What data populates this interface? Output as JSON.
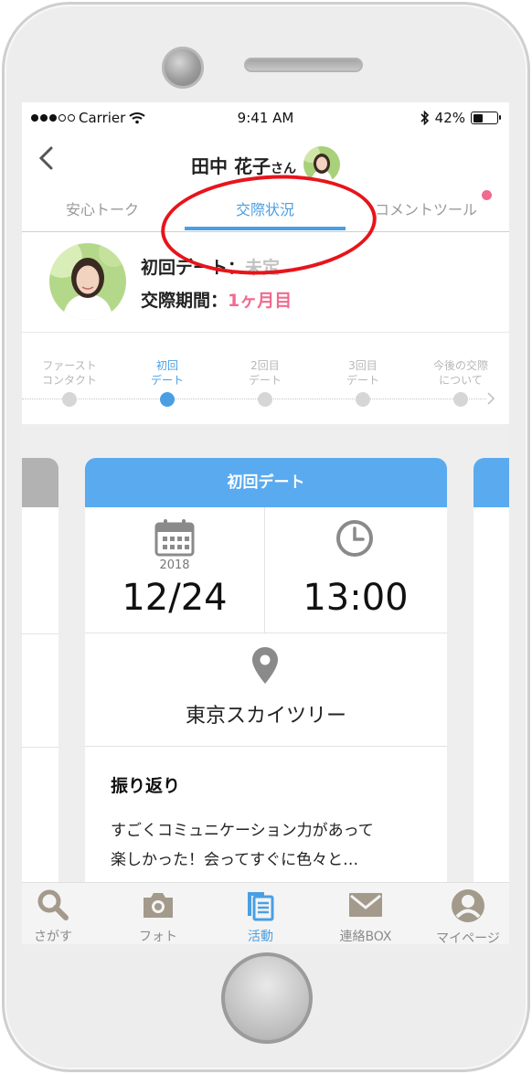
{
  "status_bar": {
    "carrier": "Carrier",
    "time": "9:41 AM",
    "battery": "42%",
    "battery_level": 0.42
  },
  "header": {
    "name": "田中 花子",
    "honorific": "さん"
  },
  "tabs": [
    {
      "label": "安心トーク",
      "active": false
    },
    {
      "label": "交際状況",
      "active": true
    },
    {
      "label": "コメントツール",
      "active": false,
      "badge": true
    }
  ],
  "profile": {
    "first_date_label": "初回デート：",
    "first_date_value": "未定",
    "period_label": "交際期間：",
    "period_value": "1ヶ月目"
  },
  "steps": [
    {
      "line1": "ファースト",
      "line2": "コンタクト",
      "active": false
    },
    {
      "line1": "初回",
      "line2": "デート",
      "active": true
    },
    {
      "line1": "2回目",
      "line2": "デート",
      "active": false
    },
    {
      "line1": "3回目",
      "line2": "デート",
      "active": false
    },
    {
      "line1": "今後の交際",
      "line2": "について",
      "active": false
    }
  ],
  "card": {
    "title": "初回デート",
    "year": "2018",
    "date": "12/24",
    "time": "13:00",
    "place": "東京スカイツリー",
    "review_title": "振り返り",
    "review_line1": "すごくコミュニケーション力があって",
    "review_line2": "楽しかった！会ってすぐに色々と…"
  },
  "tab_bar": [
    {
      "label": "さがす",
      "icon": "search-icon",
      "active": false
    },
    {
      "label": "フォト",
      "icon": "camera-icon",
      "active": false
    },
    {
      "label": "活動",
      "icon": "documents-icon",
      "active": true
    },
    {
      "label": "連絡BOX",
      "icon": "mail-icon",
      "active": false
    },
    {
      "label": "マイページ",
      "icon": "person-icon",
      "active": false
    }
  ],
  "colors": {
    "accent": "#4a9fe3",
    "pink": "#f06b8f",
    "annotation": "#e8141b"
  }
}
